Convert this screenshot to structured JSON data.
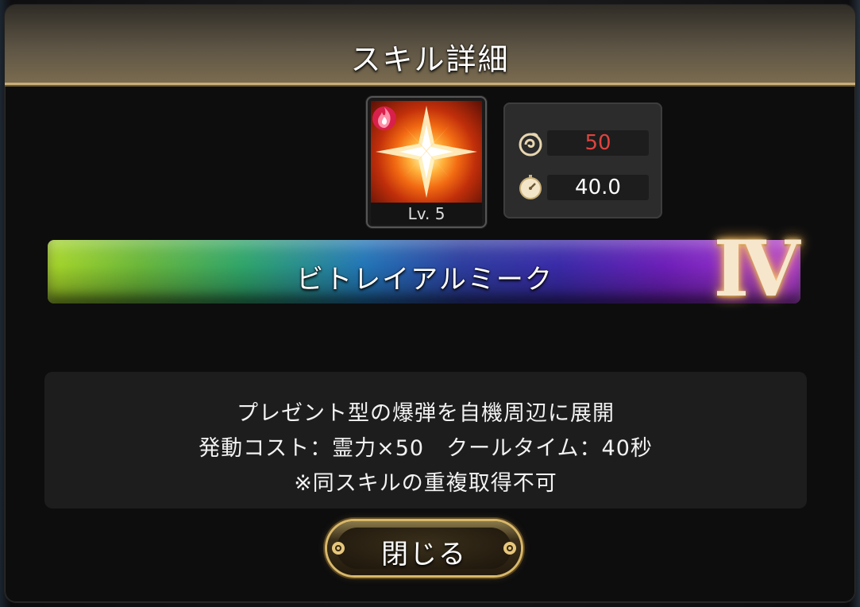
{
  "dialog": {
    "title": "スキル詳細"
  },
  "skill": {
    "icon": "starburst-explosion-icon",
    "element_icon": "fire-element-icon",
    "level_label": "Lv. 5",
    "name": "ビトレイアルミーク",
    "rank_numeral": "Ⅳ",
    "colors": {
      "cost_value": "#e0433f",
      "stat_value": "#ffffff",
      "rank_glow": "#f2a640"
    }
  },
  "stats": {
    "cost": {
      "icon": "spirit-power-icon",
      "value": "50"
    },
    "cooldown": {
      "icon": "stopwatch-icon",
      "value": "40.0"
    }
  },
  "description": {
    "lines": [
      "プレゼント型の爆弾を自機周辺に展開",
      "発動コスト：霊力×50　クールタイム：40秒",
      "※同スキルの重複取得不可"
    ]
  },
  "buttons": {
    "close_label": "閉じる"
  }
}
